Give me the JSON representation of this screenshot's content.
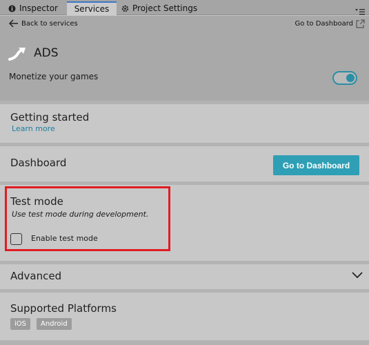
{
  "tabs": {
    "inspector": "Inspector",
    "services": "Services",
    "project_settings": "Project Settings"
  },
  "header": {
    "back_label": "Back to services",
    "goto_dashboard_link": "Go to Dashboard",
    "service_title": "ADS",
    "tagline": "Monetize your games",
    "service_enabled": true
  },
  "sections": {
    "getting_started": {
      "title": "Getting started",
      "link": "Learn more"
    },
    "dashboard": {
      "title": "Dashboard",
      "button": "Go to Dashboard"
    },
    "test_mode": {
      "title": "Test mode",
      "description": "Use test mode during development.",
      "checkbox_label": "Enable test mode",
      "checked": false
    },
    "advanced": {
      "title": "Advanced"
    },
    "platforms": {
      "title": "Supported Platforms",
      "badges": [
        "iOS",
        "Android"
      ]
    }
  },
  "colors": {
    "accent": "#2f9fb5",
    "link": "#1d7fa0",
    "highlight": "#e11b22"
  },
  "icons": [
    "info-icon",
    "gear-icon",
    "tab-menu-icon",
    "back-arrow-icon",
    "external-link-icon",
    "ads-arrow-icon",
    "chevron-down-icon"
  ]
}
